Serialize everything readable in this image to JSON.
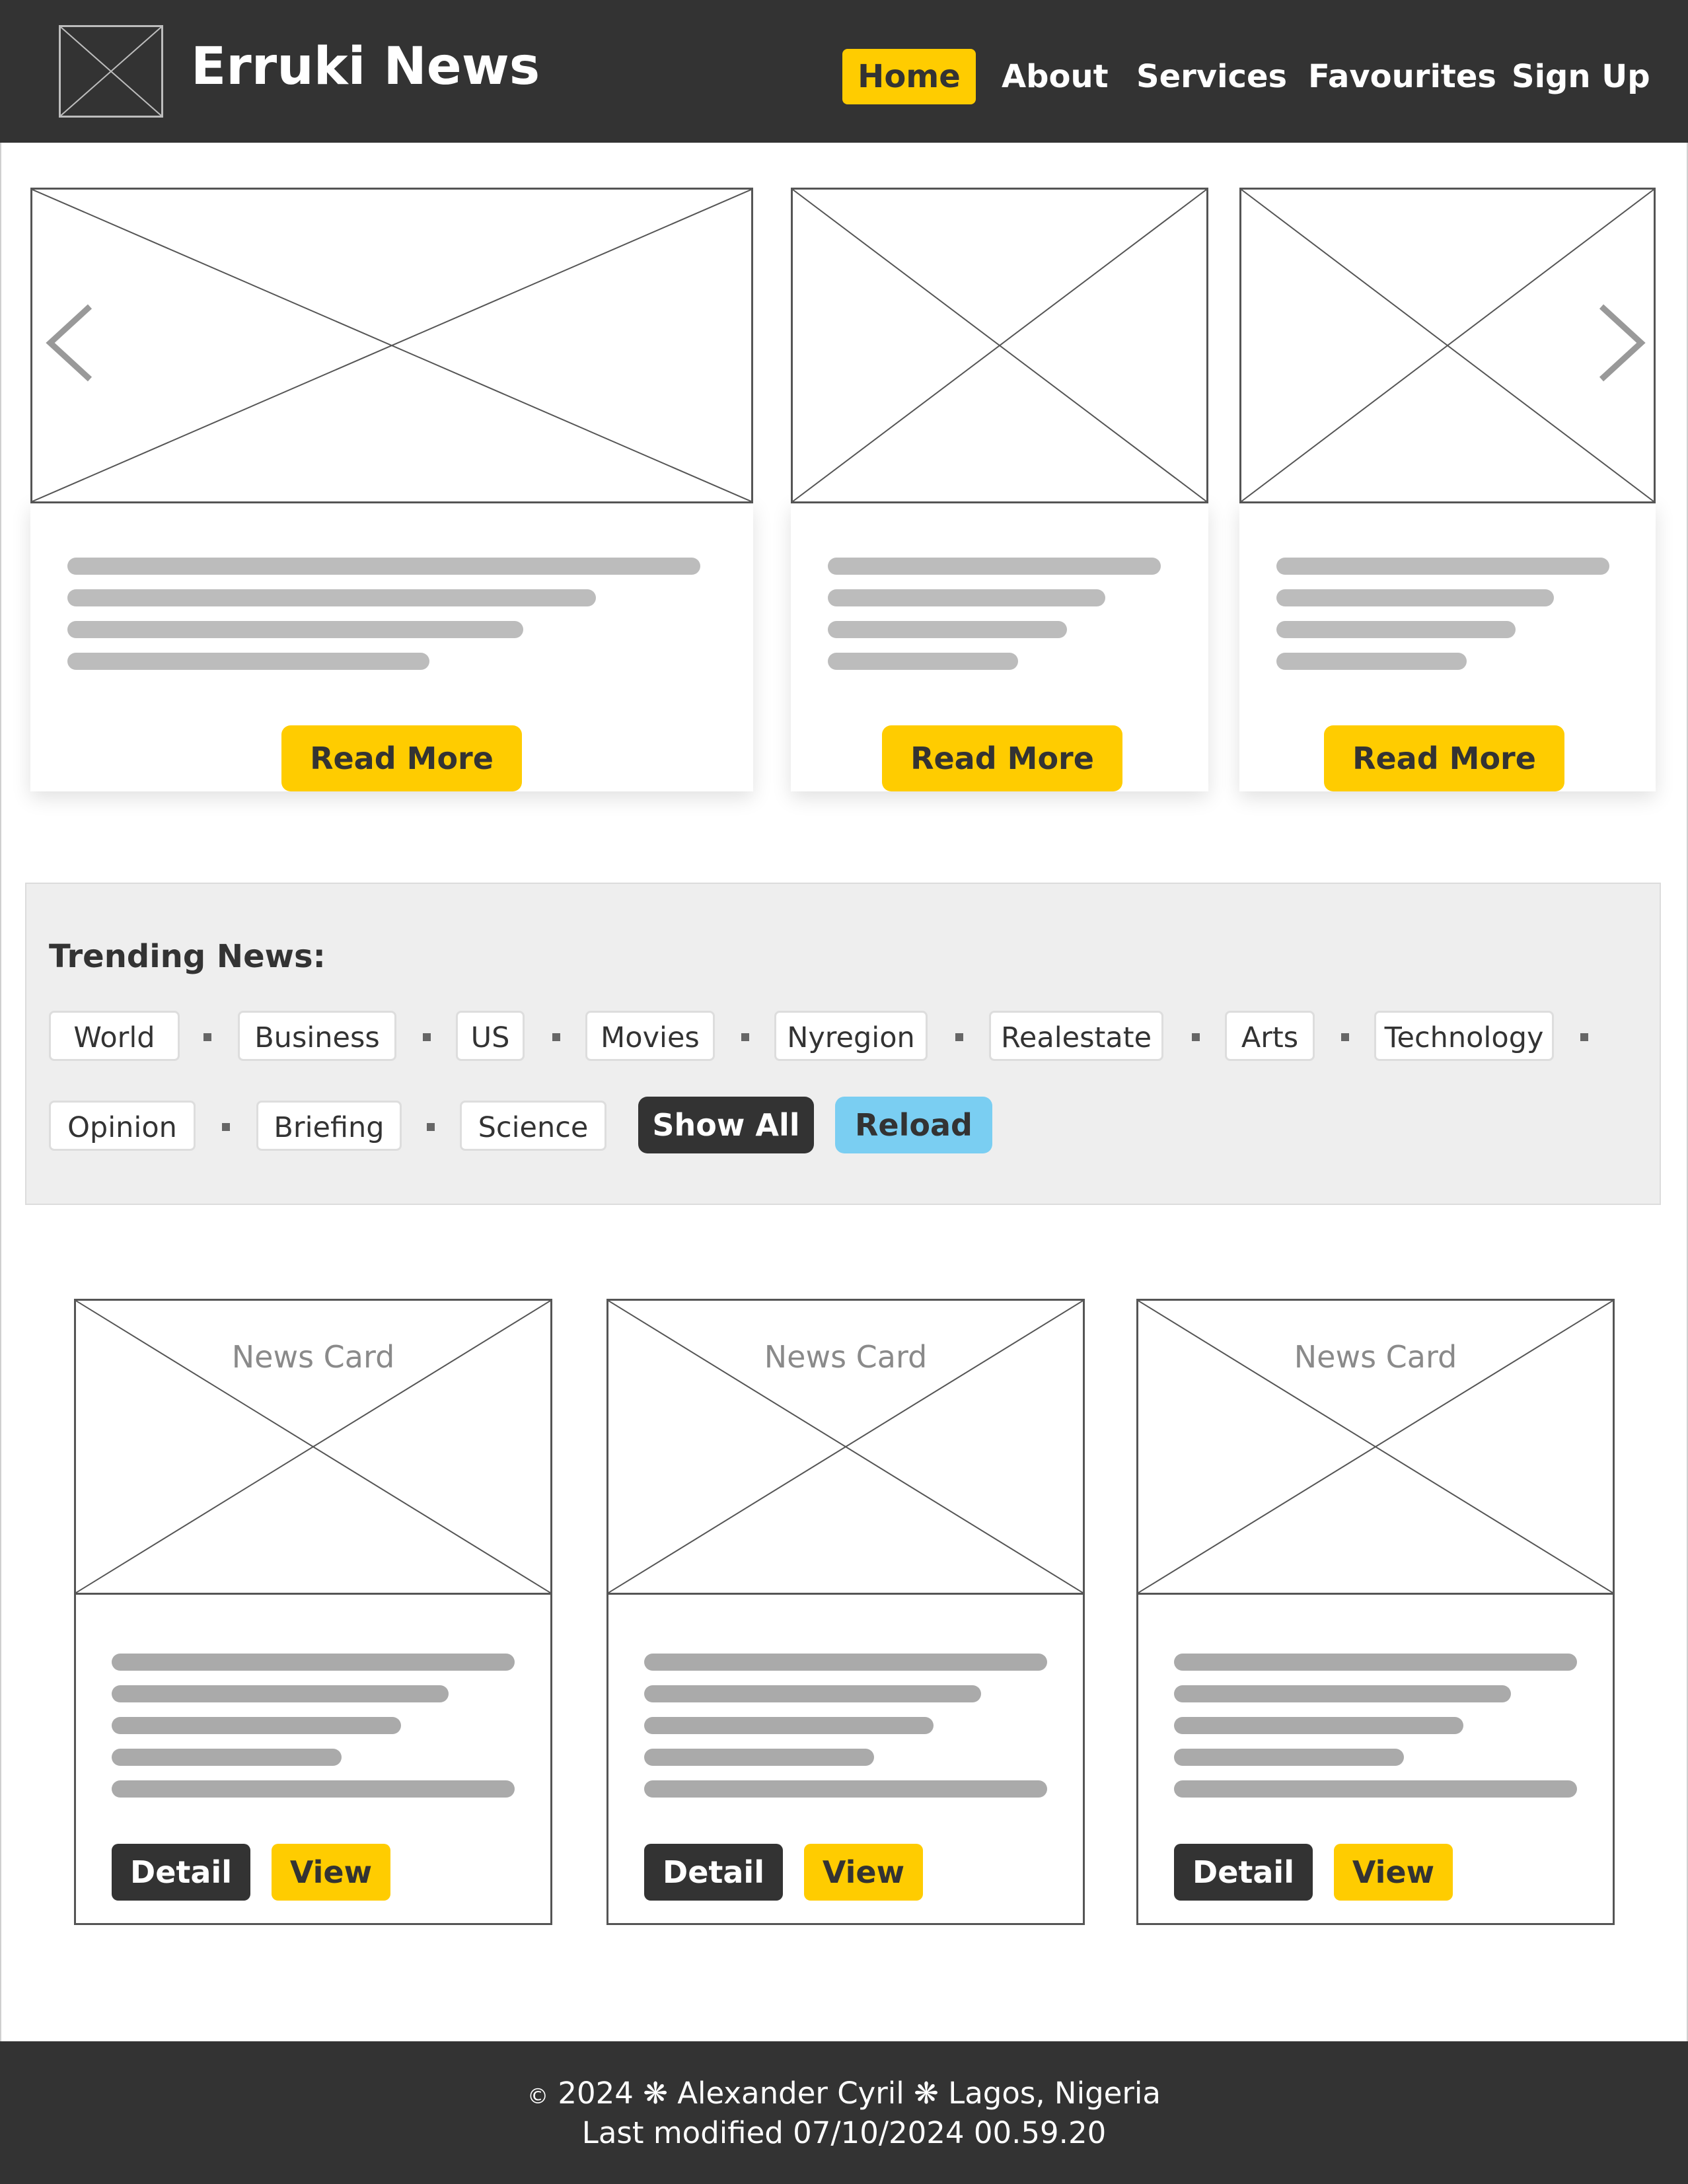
{
  "header": {
    "brand": "Erruki News",
    "nav": [
      "Home",
      "About",
      "Services",
      "Favourites",
      "Sign Up"
    ],
    "active_nav": "Home"
  },
  "carousel": {
    "slides": [
      {
        "button": "Read More"
      },
      {
        "button": "Read More"
      },
      {
        "button": "Read More"
      }
    ]
  },
  "trending": {
    "title": "Trending News:",
    "tags": [
      "World",
      "Business",
      "US",
      "Movies",
      "Nyregion",
      "Realestate",
      "Arts",
      "Technology",
      "Opinion",
      "Briefing",
      "Science"
    ],
    "show_all": "Show All",
    "reload": "Reload"
  },
  "cards": [
    {
      "title": "News Card",
      "detail": "Detail",
      "view": "View"
    },
    {
      "title": "News Card",
      "detail": "Detail",
      "view": "View"
    },
    {
      "title": "News Card",
      "detail": "Detail",
      "view": "View"
    }
  ],
  "footer": {
    "copyright_symbol": "©",
    "year": "2024",
    "separator": "❋",
    "author": "Alexander Cyril",
    "location": "Lagos, Nigeria",
    "last_modified": "Last modified 07/10/2024 00.59.20"
  },
  "colors": {
    "header_bg": "#333333",
    "accent_yellow": "#ffcc00",
    "reload_blue": "#7acef2",
    "trending_bg": "#eeeeee"
  }
}
